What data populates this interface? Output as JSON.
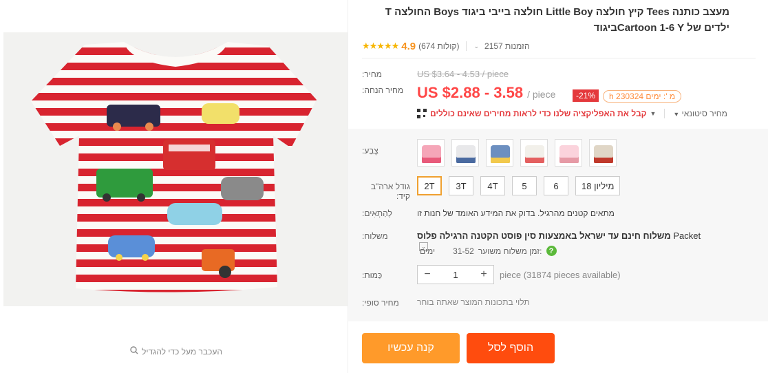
{
  "product": {
    "title": "מעצב כותנה Tees קיץ חולצה Little Boy חולצה בייבי ביגוד Boys החולצה T ילדים של Cartoon 1-6 Yביגוד",
    "image_alt": "striped t-shirt with cars",
    "zoom_hint": "העכבר מעל כדי להגדיל"
  },
  "rating": {
    "stars": "★★★★★",
    "score": "4.9",
    "reviews": "(674 קולות)",
    "orders": "2157 הזמנות"
  },
  "pricing": {
    "price_label": "מחיר:",
    "old_price": "US $3.64 - 4.53 / piece",
    "discount_label": "מחיר הנחה:",
    "price": "US $2.88 - 3.58",
    "unit": "/ piece",
    "discount": "-21%",
    "timer": "מ ': ימים 230324 h",
    "app_offer": "קבל את האפליקציה שלנו כדי לראות מחירים שאינם כוללים",
    "wholesale": "מחיר סיטונאי"
  },
  "options": {
    "color_label": "צֶבַע:",
    "colors": [
      {
        "name": "pink-cars",
        "shirt": "#f5a6b8",
        "accent": "#e85a7a"
      },
      {
        "name": "white-bus",
        "shirt": "#e8e8ea",
        "accent": "#4a6aa0"
      },
      {
        "name": "blue-cars",
        "shirt": "#6c8fc0",
        "accent": "#f2c94c"
      },
      {
        "name": "balloon",
        "shirt": "#f2f0ea",
        "accent": "#e46060"
      },
      {
        "name": "unicorn",
        "shirt": "#fbd3dc",
        "accent": "#e69aa6"
      },
      {
        "name": "striped-cars",
        "shirt": "#e0d6c6",
        "accent": "#c0392b"
      }
    ],
    "size_label": "גודל ארה\"ב קיד:",
    "sizes": [
      "2T",
      "3T",
      "4T",
      "5",
      "6",
      "18 מיליון"
    ],
    "selected_size": "2T",
    "fit_label": "לְהַתְאִים:",
    "fit_note": "מתאים קטנים מהרגיל. בדוק את המידע האומד של חנות זו"
  },
  "shipping": {
    "label": "משלוח:",
    "carrier": "Packet",
    "method": "משלוח חינם עד ישראל באמצעות סין פוסט הקטנה הרגילה פלוס",
    "eta_label": "זמן משלוח משוער:",
    "eta_value": "31-52",
    "eta_unit": "ימים"
  },
  "quantity": {
    "label": "כַּמוּת:",
    "value": "1",
    "minus": "−",
    "plus": "+",
    "available": "piece (31874 pieces available)"
  },
  "final_price": {
    "label": "מחיר סופי:",
    "note": "תלוי בתכונות המוצר שאתה בוחר"
  },
  "actions": {
    "buy_now": "קנה עכשיו",
    "add_to_cart": "הוסף לסל"
  }
}
